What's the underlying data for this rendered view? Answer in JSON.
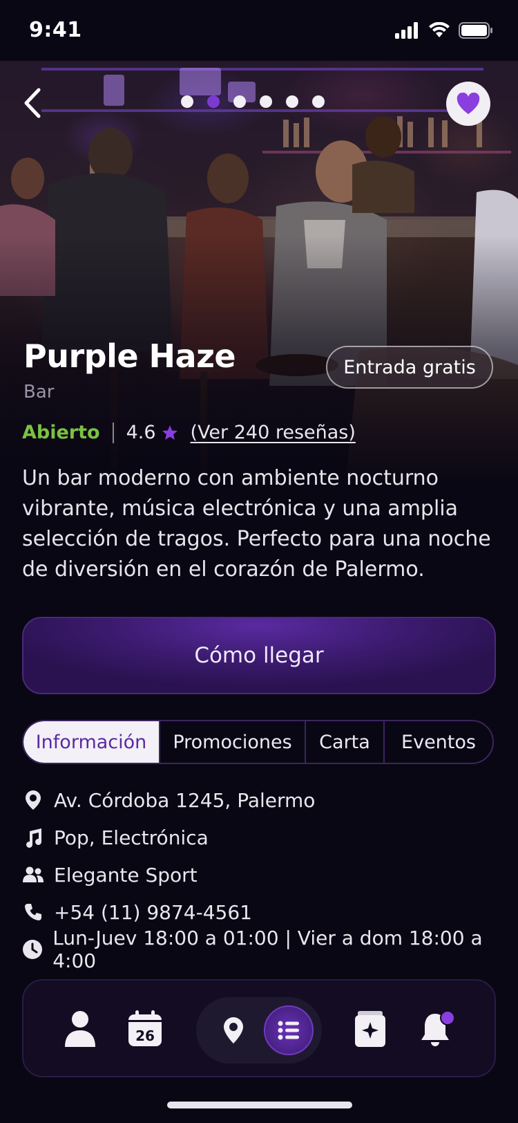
{
  "status_bar": {
    "time": "9:41"
  },
  "venue": {
    "name": "Purple Haze",
    "type": "Bar",
    "entry_badge": "Entrada gratis",
    "status": "Abierto",
    "rating": "4.6",
    "reviews_link": "(Ver 240 reseñas)",
    "description": "Un bar moderno con ambiente nocturno vibrante, música electrónica y una amplia selección de tragos. Perfecto para una noche de diversión en el corazón de Palermo."
  },
  "carousel": {
    "total": 6,
    "active_index": 1
  },
  "actions": {
    "directions_label": "Cómo llegar"
  },
  "tabs": [
    {
      "label": "Información",
      "active": true
    },
    {
      "label": "Promociones",
      "active": false
    },
    {
      "label": "Carta",
      "active": false
    },
    {
      "label": "Eventos",
      "active": false
    }
  ],
  "info": {
    "address": "Av. Córdoba 1245, Palermo",
    "music": "Pop, Electrónica",
    "dress_code": "Elegante Sport",
    "phone": "+54 (11) 9874-4561",
    "hours": "Lun-Juev 18:00 a 01:00 | Vier a dom 18:00 a 4:00"
  },
  "bottom_nav": {
    "calendar_day": "26",
    "items": [
      "profile-icon",
      "calendar-icon",
      "map-pin-icon",
      "list-icon",
      "wallet-star-icon",
      "bell-icon"
    ]
  },
  "colors": {
    "accent_purple": "#7c3bd0",
    "open_green": "#7bc241",
    "background": "#0a0714"
  }
}
